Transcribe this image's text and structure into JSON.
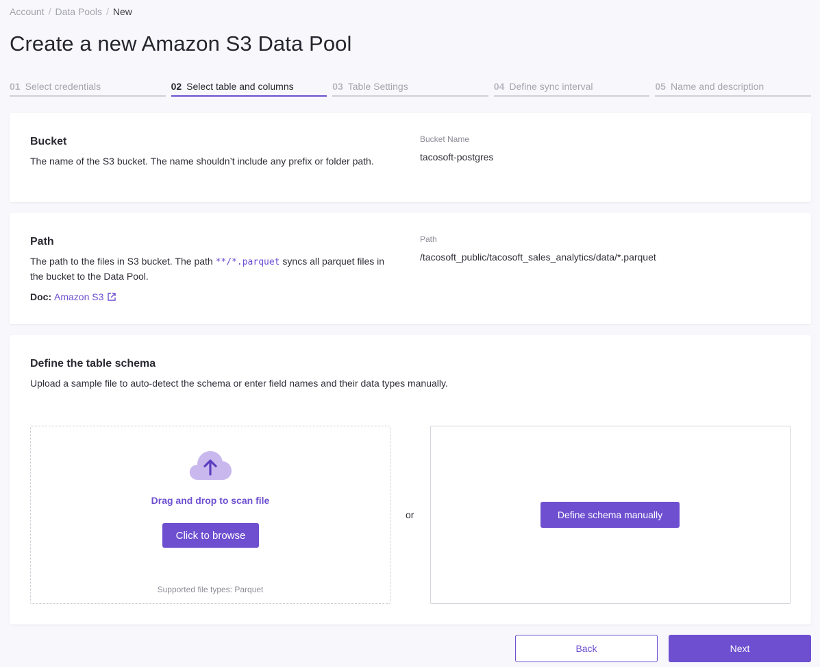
{
  "breadcrumb": {
    "items": [
      "Account",
      "Data Pools"
    ],
    "current": "New",
    "separator": "/"
  },
  "page_title": "Create a new Amazon S3 Data Pool",
  "steps": [
    {
      "num": "01",
      "label": "Select credentials",
      "state": "done"
    },
    {
      "num": "02",
      "label": "Select table and columns",
      "state": "active"
    },
    {
      "num": "03",
      "label": "Table Settings",
      "state": "pending"
    },
    {
      "num": "04",
      "label": "Define sync interval",
      "state": "pending"
    },
    {
      "num": "05",
      "label": "Name and description",
      "state": "pending"
    }
  ],
  "bucket": {
    "title": "Bucket",
    "description": "The name of the S3 bucket. The name shouldn’t include any prefix or folder path.",
    "field_label": "Bucket Name",
    "field_value": "tacosoft-postgres"
  },
  "path": {
    "title": "Path",
    "description_before": "The path to the files in S3 bucket. The path ",
    "description_code": "**/*.parquet",
    "description_after": " syncs all parquet files in the bucket to the Data Pool.",
    "doc_label": "Doc:",
    "doc_link": "Amazon S3",
    "field_label": "Path",
    "field_value": "/tacosoft_public/tacosoft_sales_analytics/data/*.parquet"
  },
  "schema": {
    "title": "Define the table schema",
    "description": "Upload a sample file to auto-detect the schema or enter field names and their data types manually.",
    "drop_text": "Drag and drop to scan file",
    "browse_button": "Click to browse",
    "file_types": "Supported file types: Parquet",
    "or_text": "or",
    "manual_button": "Define schema manually"
  },
  "footer": {
    "back_button": "Back",
    "next_button": "Next"
  },
  "colors": {
    "accent": "#6d4fd0",
    "cloud": "#c9b8ee",
    "background": "#f8f8fc"
  },
  "icons": {
    "cloud": "cloud-upload-icon",
    "external": "external-link-icon"
  }
}
